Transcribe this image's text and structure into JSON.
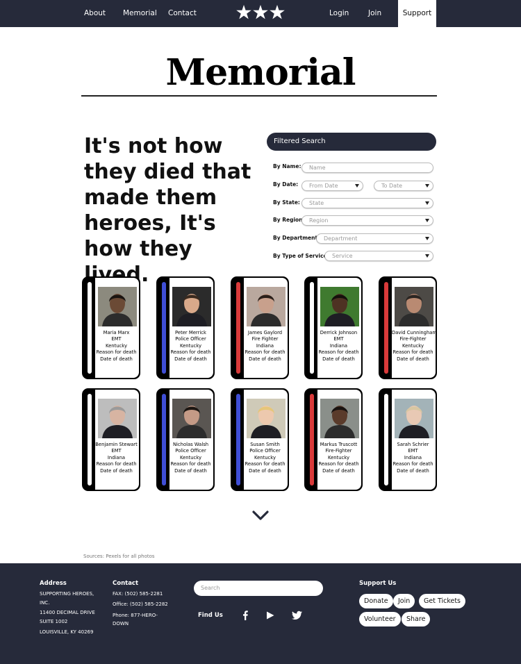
{
  "nav": {
    "left": [
      "About",
      "Memorial",
      "Contact"
    ],
    "right": [
      "Login",
      "Join",
      "Support"
    ],
    "logo_icon": "three-stars-icon"
  },
  "page": {
    "title": "Memorial",
    "hero": "It's not how they died that made them heroes, It's how they lived."
  },
  "filter": {
    "header": "Filtered Search",
    "fields": [
      {
        "label": "By Name:",
        "placeholder": "Name"
      },
      {
        "label": "By Date:",
        "placeholder": "From Date",
        "placeholder2": "To Date"
      },
      {
        "label": "By State:",
        "placeholder": "State"
      },
      {
        "label": "By Region:",
        "placeholder": "Region"
      },
      {
        "label": "By Department:",
        "placeholder": "Department"
      },
      {
        "label": "By Type of Service:",
        "placeholder": "Service"
      }
    ]
  },
  "colors": {
    "emt": "#ffffff",
    "police": "#3f4ed6",
    "fire": "#d93a3a",
    "navy": "#262a3a"
  },
  "heroes": [
    {
      "name": "Maria Marx",
      "role": "EMT",
      "state": "Kentucky",
      "reason": "Reason for death",
      "date": "Date of death",
      "stripe": "#ffffff"
    },
    {
      "name": "Peter Merrick",
      "role": "Police Officer",
      "state": "Kentucky",
      "reason": "Reason for death",
      "date": "Date of death",
      "stripe": "#3f4ed6"
    },
    {
      "name": "James Gaylord",
      "role": "Fire Fighter",
      "state": "Indiana",
      "reason": "Reason for death",
      "date": "Date of death",
      "stripe": "#d93a3a"
    },
    {
      "name": "Derrick Johnson",
      "role": "EMT",
      "state": "Indiana",
      "reason": "Reason for death",
      "date": "Date of death",
      "stripe": "#ffffff"
    },
    {
      "name": "David Cunningham",
      "role": "Fire-Fighter",
      "state": "Kentucky",
      "reason": "Reason for death",
      "date": "Date of death",
      "stripe": "#d93a3a"
    },
    {
      "name": "Benjamin Stewart",
      "role": "EMT",
      "state": "Indiana",
      "reason": "Reason for death",
      "date": "Date of death",
      "stripe": "#ffffff"
    },
    {
      "name": "Nicholas Walsh",
      "role": "Police Officer",
      "state": "Kentucky",
      "reason": "Reason for death",
      "date": "Date of death",
      "stripe": "#3f4ed6"
    },
    {
      "name": "Susan Smith",
      "role": "Police Officer",
      "state": "Kentucky",
      "reason": "Reason for death",
      "date": "Date of death",
      "stripe": "#3f4ed6"
    },
    {
      "name": "Markus Truscott",
      "role": "Fire-Fighter",
      "state": "Kentucky",
      "reason": "Reason for death",
      "date": "Date of death",
      "stripe": "#d93a3a"
    },
    {
      "name": "Sarah Schrier",
      "role": "EMT",
      "state": "Indiana",
      "reason": "Reason for death",
      "date": "Date of death",
      "stripe": "#ffffff"
    }
  ],
  "sources": "Sources: Pexels for all photos",
  "footer": {
    "address_head": "Address",
    "address_lines": [
      "SUPPORTING HEROES,",
      "INC.",
      "11400 DECIMAL DRIVE",
      "SUITE 1002",
      "LOUISVILLE, KY 40269"
    ],
    "contact_head": "Contact",
    "contact_lines": [
      "FAX: (502) 585-2281",
      "Office: (502) 585-2282",
      "Phone: 877-HERO-",
      "DOWN"
    ],
    "search_placeholder": "Search",
    "find_us": "Find Us",
    "social_icons": [
      "facebook-icon",
      "youtube-icon",
      "twitter-icon"
    ],
    "support_head": "Support Us",
    "support_buttons": [
      "Donate",
      "Join",
      "Get Tickets",
      "Volunteer",
      "Share"
    ]
  }
}
